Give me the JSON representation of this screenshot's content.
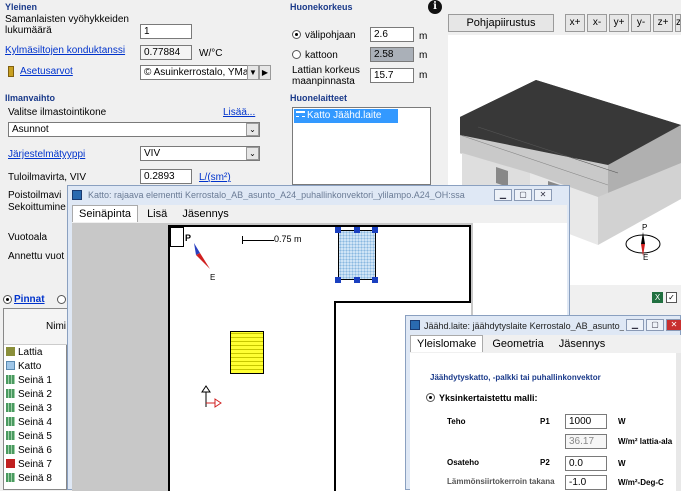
{
  "yleinen": {
    "title": "Yleinen",
    "kerrosluku_label": "Samanlaisten vyöhykkeiden lukumäärä",
    "kerrosluku_value": "1",
    "kylmasilta_label": "Kylmäsiltojen konduktanssi",
    "kylmasilta_value": "0.77884",
    "kylmasilta_unit": "W/°C",
    "asetusarvot_label": "Asetusarvot",
    "asetusarvot_value": "© Asuinkerrostalo, YMa"
  },
  "huonekorkeus": {
    "title": "Huonekorkeus",
    "valipohjaan_label": "välipohjaan",
    "valipohjaan_value": "2.6",
    "kattoon_label": "kattoon",
    "kattoon_value": "2.58",
    "lattia_label": "Lattian korkeus maanpinnasta",
    "lattia_value": "15.7",
    "unit": "m"
  },
  "ilmanvaihto": {
    "title": "Ilmanvaihto",
    "valitse_label": "Valitse ilmastointikone",
    "lisaa_link": "Lisää...",
    "kone_value": "Asunnot",
    "jarjestelma_label": "Järjestelmätyyppi",
    "jarjestelma_value": "VIV",
    "tuloilma_label": "Tuloilmavirta, VIV",
    "tuloilma_value": "0.2893",
    "tuloilma_unit": "L/(sm²)",
    "poisto_label": "Poistoilmavi",
    "sekoitus_label": "Sekoittumine",
    "vuotoala_label": "Vuotoala",
    "annettu_label": "Annettu vuot"
  },
  "huonelaitteet": {
    "title": "Huonelaitteet",
    "items": [
      "Katto Jäähd.laite"
    ]
  },
  "toolbar": {
    "pohjapiirustus": "Pohjapiirustus",
    "buttons": [
      "x+",
      "x-",
      "y+",
      "y-",
      "z+",
      "z-"
    ]
  },
  "left_list": {
    "radio_label": "Pinnat",
    "col_header": "Nimi",
    "items": [
      {
        "label": "Lattia",
        "color": "#8a8f3a"
      },
      {
        "label": "Katto",
        "color": "#9fc6e8"
      },
      {
        "label": "Seinä 1",
        "color": "#4a9a60"
      },
      {
        "label": "Seinä 2",
        "color": "#4a9a60"
      },
      {
        "label": "Seinä 3",
        "color": "#4a9a60"
      },
      {
        "label": "Seinä 4",
        "color": "#4a9a60"
      },
      {
        "label": "Seinä 5",
        "color": "#4a9a60"
      },
      {
        "label": "Seinä 6",
        "color": "#4a9a60"
      },
      {
        "label": "Seinä 7",
        "color": "#c02020"
      },
      {
        "label": "Seinä 8",
        "color": "#4a9a60"
      }
    ]
  },
  "katto_window": {
    "title": "Katto: rajaava elementti Kerrostalo_AB_asunto_A24_puhallinkonvektori_ylilampo.A24_OH:ssa",
    "tabs": [
      "Seinäpinta",
      "Lisä",
      "Jäsennys"
    ],
    "scale_label": "0.75 m",
    "north": "P",
    "east": "E"
  },
  "jaahd_window": {
    "title": "Jäähd.laite: jäähdytyslaite Kerrostalo_AB_asunto_A...",
    "tabs": [
      "Yleislomake",
      "Geometria",
      "Jäsennys"
    ],
    "header": "Jäähdytyskatto, -palkki tai puhallinkonvektor",
    "model_label": "Yksinkertaistettu malli:",
    "teho_label": "Teho",
    "teho_sym": "P1",
    "teho_value": "1000",
    "teho_unit": "W",
    "teho2_value": "36.17",
    "teho2_unit": "W/m² lattia-ala",
    "osateho_label": "Osateho",
    "osateho_sym": "P2",
    "osateho_value": "0.0",
    "osateho_unit": "W",
    "lammon_label": "Lämmönsiirtokerroin takana",
    "lammon_value": "-1.0",
    "lammon_unit": "W/m²-Deg-C"
  },
  "compass3d": {
    "north": "P",
    "east": "E"
  },
  "colors": {
    "accent": "#1a3a8a",
    "link": "#0033cc",
    "selection": "#3399ff",
    "device_yellow": "#ffff33"
  }
}
